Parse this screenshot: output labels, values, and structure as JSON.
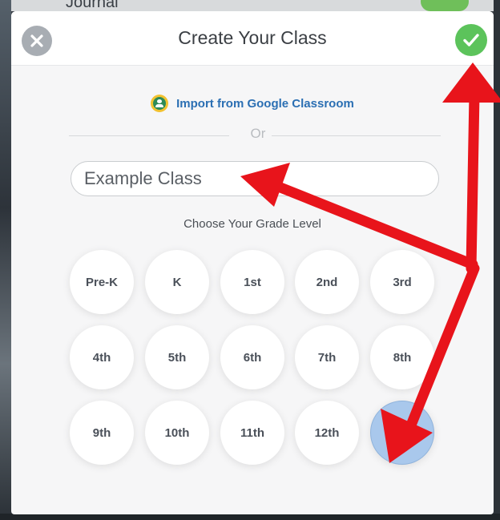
{
  "background": {
    "title_fragment": "Journal"
  },
  "modal": {
    "title": "Create Your Class",
    "close_icon": "close-icon",
    "confirm_icon": "checkmark-icon"
  },
  "import": {
    "label": "Import from Google Classroom",
    "icon": "google-classroom-icon"
  },
  "divider": {
    "text": "Or"
  },
  "class_name": {
    "placeholder": "Example Class",
    "value": ""
  },
  "grade": {
    "label": "Choose Your Grade Level",
    "options": [
      "Pre-K",
      "K",
      "1st",
      "2nd",
      "3rd",
      "4th",
      "5th",
      "6th",
      "7th",
      "8th",
      "9th",
      "10th",
      "11th",
      "12th",
      ""
    ],
    "selected_index": 14
  },
  "annotations": {
    "arrow_color": "#e8141b",
    "arrows": [
      "to-class-input",
      "to-confirm-button",
      "to-selected-grade"
    ]
  },
  "colors": {
    "accent_green": "#5cc35b",
    "link_blue": "#2b6fb3",
    "selected_grade": "#a9c8ec"
  }
}
